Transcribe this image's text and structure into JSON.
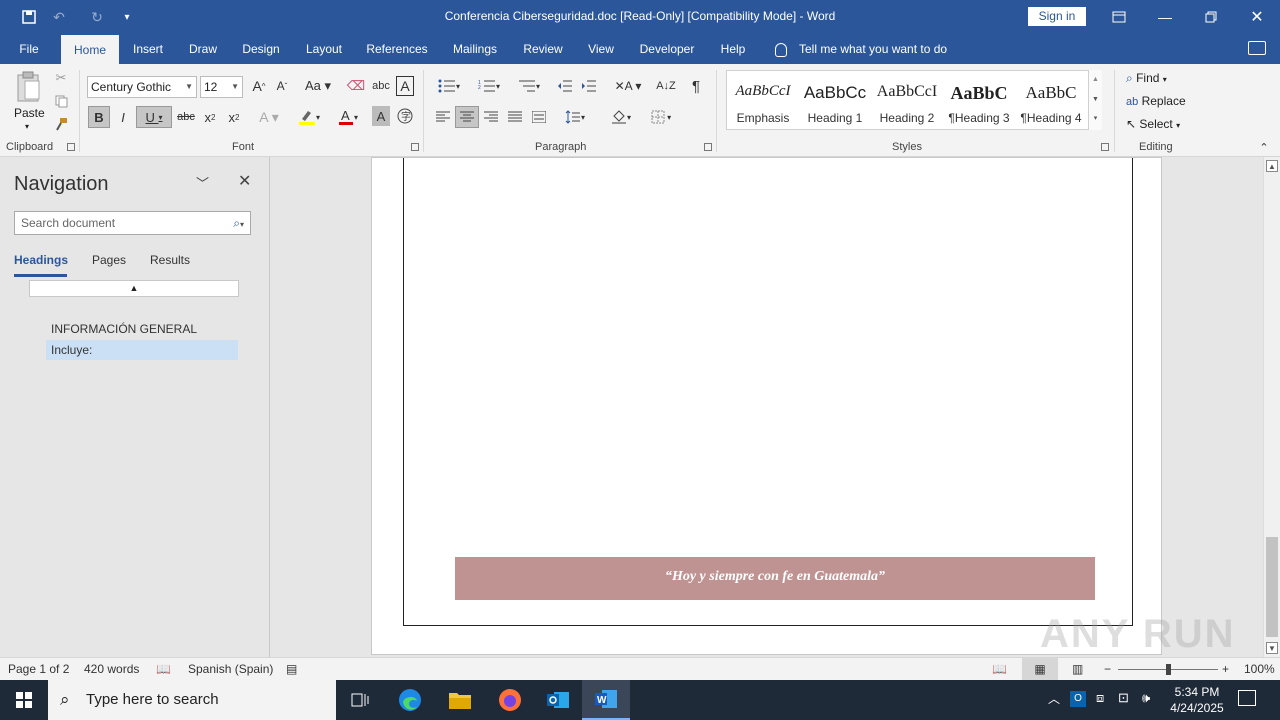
{
  "titlebar": {
    "title": "Conferencia Ciberseguridad.doc [Read-Only] [Compatibility Mode]  -  Word",
    "signin": "Sign in"
  },
  "tabs": [
    "File",
    "Home",
    "Insert",
    "Draw",
    "Design",
    "Layout",
    "References",
    "Mailings",
    "Review",
    "View",
    "Developer",
    "Help"
  ],
  "active_tab": "Home",
  "tellme": "Tell me what you want to do",
  "ribbon": {
    "clipboard": {
      "label": "Clipboard",
      "paste": "Paste"
    },
    "font": {
      "label": "Font",
      "family": "Century Gothic",
      "size": "12"
    },
    "paragraph": {
      "label": "Paragraph"
    },
    "styles": {
      "label": "Styles",
      "items": [
        {
          "preview": "AaBbCcI",
          "name": "Emphasis"
        },
        {
          "preview": "AaBbCc",
          "name": "Heading 1"
        },
        {
          "preview": "AaBbCcI",
          "name": "Heading 2"
        },
        {
          "preview": "AaBbC",
          "name": "¶Heading 3"
        },
        {
          "preview": "AaBbC",
          "name": "¶Heading 4"
        }
      ]
    },
    "editing": {
      "label": "Editing",
      "find": "Find",
      "replace": "Replace",
      "select": "Select"
    }
  },
  "navigation": {
    "title": "Navigation",
    "search_placeholder": "Search document",
    "tabs": [
      "Headings",
      "Pages",
      "Results"
    ],
    "headings": [
      "INFORMACIÓN GENERAL",
      "Incluye:"
    ]
  },
  "document": {
    "banner_text": "“Hoy y siempre con fe en Guatemala”"
  },
  "statusbar": {
    "page": "Page 1 of 2",
    "words": "420 words",
    "language": "Spanish (Spain)",
    "zoom": "100%"
  },
  "taskbar": {
    "search_placeholder": "Type here to search",
    "time": "5:34 PM",
    "date": "4/24/2025"
  },
  "watermark": "ANY RUN"
}
